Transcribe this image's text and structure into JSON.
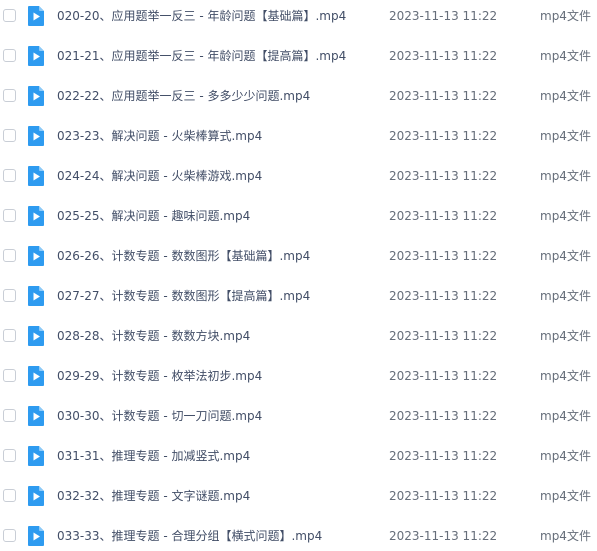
{
  "files": [
    {
      "name": "020-20、应用题举一反三 - 年龄问题【基础篇】.mp4",
      "date": "2023-11-13 11:22",
      "type": "mp4文件",
      "icon": "video-file-icon"
    },
    {
      "name": "021-21、应用题举一反三 - 年龄问题【提高篇】.mp4",
      "date": "2023-11-13 11:22",
      "type": "mp4文件",
      "icon": "video-file-icon"
    },
    {
      "name": "022-22、应用题举一反三 - 多多少少问题.mp4",
      "date": "2023-11-13 11:22",
      "type": "mp4文件",
      "icon": "video-file-icon"
    },
    {
      "name": "023-23、解决问题 - 火柴棒算式.mp4",
      "date": "2023-11-13 11:22",
      "type": "mp4文件",
      "icon": "video-file-icon"
    },
    {
      "name": "024-24、解决问题 - 火柴棒游戏.mp4",
      "date": "2023-11-13 11:22",
      "type": "mp4文件",
      "icon": "video-file-icon"
    },
    {
      "name": "025-25、解决问题 - 趣味问题.mp4",
      "date": "2023-11-13 11:22",
      "type": "mp4文件",
      "icon": "video-file-icon"
    },
    {
      "name": "026-26、计数专题 - 数数图形【基础篇】.mp4",
      "date": "2023-11-13 11:22",
      "type": "mp4文件",
      "icon": "video-file-icon"
    },
    {
      "name": "027-27、计数专题 - 数数图形【提高篇】.mp4",
      "date": "2023-11-13 11:22",
      "type": "mp4文件",
      "icon": "video-file-icon"
    },
    {
      "name": "028-28、计数专题 - 数数方块.mp4",
      "date": "2023-11-13 11:22",
      "type": "mp4文件",
      "icon": "video-file-icon"
    },
    {
      "name": "029-29、计数专题 - 枚举法初步.mp4",
      "date": "2023-11-13 11:22",
      "type": "mp4文件",
      "icon": "video-file-icon"
    },
    {
      "name": "030-30、计数专题 - 切一刀问题.mp4",
      "date": "2023-11-13 11:22",
      "type": "mp4文件",
      "icon": "video-file-icon"
    },
    {
      "name": "031-31、推理专题 - 加减竖式.mp4",
      "date": "2023-11-13 11:22",
      "type": "mp4文件",
      "icon": "video-file-icon"
    },
    {
      "name": "032-32、推理专题 - 文字谜题.mp4",
      "date": "2023-11-13 11:22",
      "type": "mp4文件",
      "icon": "video-file-icon"
    },
    {
      "name": "033-33、推理专题 - 合理分组【横式问题】.mp4",
      "date": "2023-11-13 11:22",
      "type": "mp4文件",
      "icon": "video-file-icon"
    }
  ],
  "colors": {
    "icon_blue": "#2e9bf0",
    "icon_fold": "#8ccaf8",
    "text": "#424e67",
    "meta_text": "#666e7a",
    "checkbox_border": "#c9ced6"
  }
}
